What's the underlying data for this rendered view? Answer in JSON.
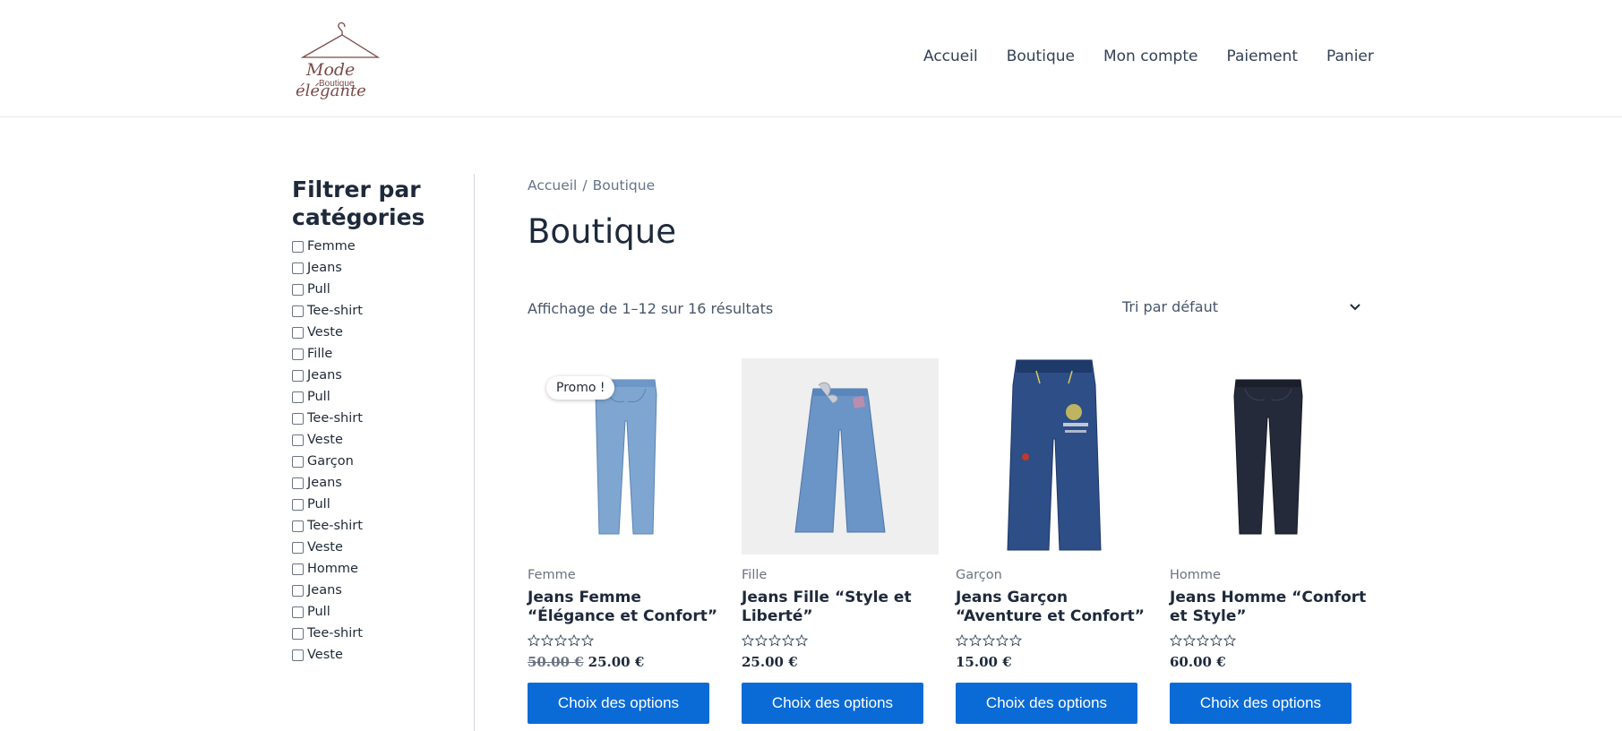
{
  "header": {
    "logo_text_1": "Mode",
    "logo_text_2": "Boutique",
    "logo_text_3": "élégante",
    "nav": [
      "Accueil",
      "Boutique",
      "Mon compte",
      "Paiement",
      "Panier"
    ]
  },
  "sidebar": {
    "title": "Filtrer par catégories",
    "categories": [
      "Femme",
      "Jeans",
      "Pull",
      "Tee-shirt",
      "Veste",
      "Fille",
      "Jeans",
      "Pull",
      "Tee-shirt",
      "Veste",
      "Garçon",
      "Jeans",
      "Pull",
      "Tee-shirt",
      "Veste",
      "Homme",
      "Jeans",
      "Pull",
      "Tee-shirt",
      "Veste"
    ]
  },
  "breadcrumb": {
    "home": "Accueil",
    "separator": "/",
    "current": "Boutique"
  },
  "page_title": "Boutique",
  "results_count": "Affichage de 1–12 sur 16 résultats",
  "sort": {
    "selected": "Tri par défaut"
  },
  "products": [
    {
      "badge": "Promo !",
      "category": "Femme",
      "title": "Jeans Femme “Élégance et Confort”",
      "old_price": "50.00 €",
      "price": "25.00 €",
      "button": "Choix des options",
      "image": "light-blue-jeans",
      "rating": 0
    },
    {
      "badge": "",
      "category": "Fille",
      "title": "Jeans Fille “Style et Liberté”",
      "old_price": "",
      "price": "25.00 €",
      "button": "Choix des options",
      "image": "wide-leg-jeans",
      "rating": 0
    },
    {
      "badge": "",
      "category": "Garçon",
      "title": "Jeans Garçon “Aventure et Confort”",
      "old_price": "",
      "price": "15.00 €",
      "button": "Choix des options",
      "image": "kids-dark-jeans",
      "rating": 0
    },
    {
      "badge": "",
      "category": "Homme",
      "title": "Jeans Homme “Confort et Style”",
      "old_price": "",
      "price": "60.00 €",
      "button": "Choix des options",
      "image": "dark-navy-jeans",
      "rating": 0
    }
  ],
  "colors": {
    "accent": "#0b6bd6",
    "text": "#1e293b",
    "muted": "#6b7280",
    "logo": "#7a4a48"
  }
}
